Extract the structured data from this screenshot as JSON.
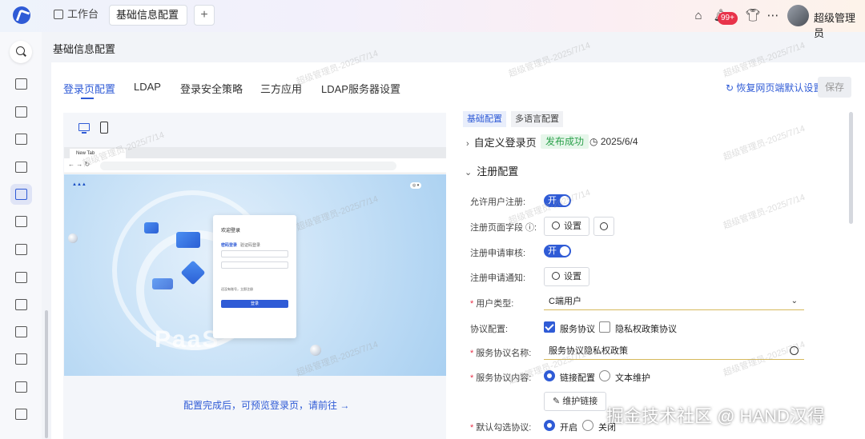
{
  "topbar": {
    "home_tab": "工作台",
    "active_tab": "基础信息配置",
    "add_tab": "+",
    "notification_badge": "99+",
    "user_name": "超级管理员"
  },
  "page": {
    "title": "基础信息配置",
    "tabs": [
      "登录页配置",
      "LDAP",
      "登录安全策略",
      "三方应用",
      "LDAP服务器设置"
    ],
    "restore_label": "恢复网页端默认设置",
    "save_label": "保存"
  },
  "preview": {
    "browser_tab": "New Tab",
    "login_title": "欢迎登录",
    "login_tab_active": "密码登录",
    "login_tab_other": "验证码登录",
    "register_hint": "还没有账号，立即注册",
    "login_button": "登录",
    "paas_text": "PaaS",
    "tip": "配置完成后，可预览登录页，请前往"
  },
  "config": {
    "subtabs": [
      "基础配置",
      "多语言配置"
    ],
    "custom_login": "自定义登录页",
    "publish_status": "发布成功",
    "publish_date": "2025/6/4",
    "register_section": "注册配置",
    "allow_register_label": "允许用户注册:",
    "toggle_on": "开",
    "register_fields_label": "注册页面字段",
    "settings_label": "设置",
    "register_review_label": "注册申请审核:",
    "register_notify_label": "注册申请通知:",
    "user_type_label": "用户类型:",
    "user_type_value": "C端用户",
    "agreement_config_label": "协议配置:",
    "service_agreement": "服务协议",
    "privacy_policy": "隐私权政策协议",
    "agreement_name_label": "服务协议名称:",
    "agreement_name_value": "服务协议隐私权政策",
    "agreement_content_label": "服务协议内容:",
    "link_config": "链接配置",
    "text_maintain": "文本维护",
    "maintain_link_label": "维护链接",
    "default_check_label": "默认勾选协议:",
    "enable": "开启",
    "disable": "关闭"
  },
  "watermark": "超级管理员-2025/7/14",
  "brand_watermark": "掘金技术社区 @ HAND汉得",
  "colors": {
    "accent": "#2f5bd6",
    "success": "#2ba14b",
    "danger": "#e8334a"
  }
}
